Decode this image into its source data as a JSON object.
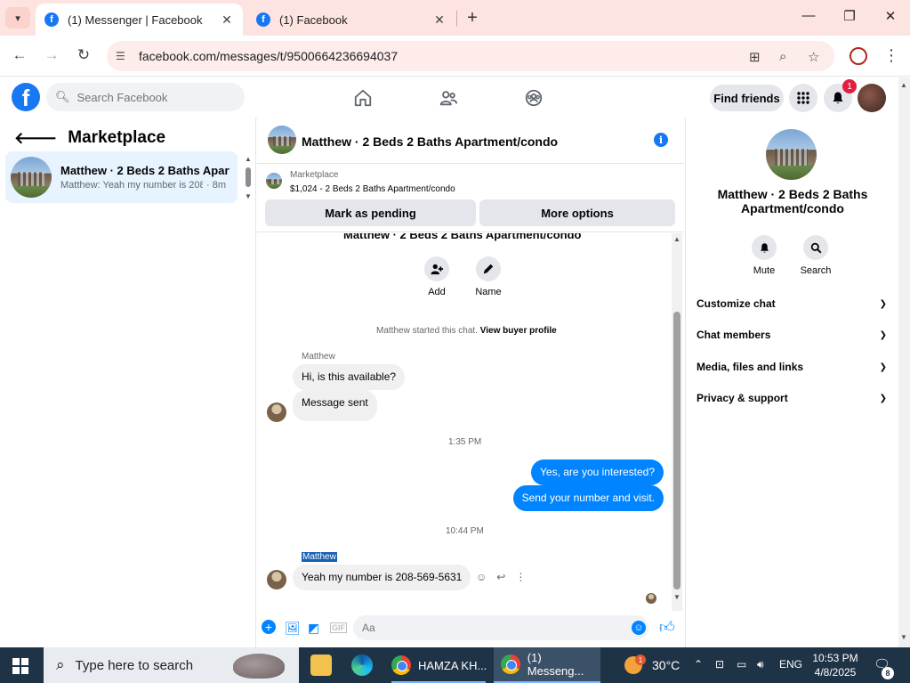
{
  "browser": {
    "tabs": [
      {
        "title": "(1) Messenger | Facebook",
        "active": true
      },
      {
        "title": "(1) Facebook",
        "active": false
      }
    ],
    "url": "facebook.com/messages/t/9500664236694037"
  },
  "fb_header": {
    "search_placeholder": "Search Facebook",
    "find_friends": "Find friends",
    "notifications_count": "1"
  },
  "sidebar": {
    "title": "Marketplace",
    "conversation": {
      "name": "Matthew · 2 Beds 2 Baths Apart...",
      "preview": "Matthew: Yeah my number is 208...",
      "time": "· 8m"
    }
  },
  "chat": {
    "title": "Matthew · 2 Beds 2 Baths Apartment/condo",
    "marketplace_label": "Marketplace",
    "listing": "$1,024 - 2 Beds 2 Baths Apartment/condo",
    "mark_pending": "Mark as pending",
    "more_options": "More options",
    "cut_title": "Matthew · 2 Beds 2 Baths Apartment/condo",
    "add_label": "Add",
    "name_label": "Name",
    "started_text": "Matthew started this chat.",
    "view_buyer": "View buyer profile",
    "messages": {
      "sender1": "Matthew",
      "m1": "Hi, is this available?",
      "m2": "Message sent",
      "time1": "1:35 PM",
      "m3": "Yes, are you interested?",
      "m4": "Send your number and visit.",
      "time2": "10:44 PM",
      "sender2": "Matthew",
      "m5": "Yeah my number is 208-569-5631"
    },
    "composer_placeholder": "Aa"
  },
  "info_panel": {
    "name": "Matthew · 2 Beds 2 Baths Apartment/condo",
    "mute": "Mute",
    "search": "Search",
    "rows": [
      "Customize chat",
      "Chat members",
      "Media, files and links",
      "Privacy & support"
    ]
  },
  "taskbar": {
    "search_placeholder": "Type here to search",
    "app1": "HAMZA KH...",
    "app2": "(1) Messeng...",
    "weather": "30°C",
    "lang": "ENG",
    "time": "10:53 PM",
    "date": "4/8/2025",
    "notif_count": "8",
    "weather_badge": "1"
  },
  "colors": {
    "fb_blue": "#1877f2",
    "messenger_blue": "#0084ff",
    "tab_strip": "#fde4e1"
  }
}
